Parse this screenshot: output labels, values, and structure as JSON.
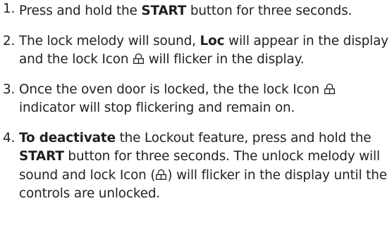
{
  "steps": [
    {
      "num": "1.",
      "t1": "Press and hold the ",
      "b1": "START",
      "t2": " button for three seconds."
    },
    {
      "num": "2.",
      "t1": "The lock melody will sound, ",
      "b1": "Loc",
      "t2": " will appear in the display and the lock Icon ",
      "t3": " will flicker in the display."
    },
    {
      "num": "3.",
      "t1": "Once the oven door is locked, the the lock Icon ",
      "t2": " indicator will stop flickering and remain on."
    },
    {
      "num": "4.",
      "b1": "To deactivate",
      "t1": " the Lockout feature, press and hold the ",
      "b2": "START",
      "t2": " button for three seconds. The unlock melody will sound and lock Icon (",
      "t3": ") will flicker in the display until the controls are unlocked."
    }
  ],
  "icon": "lock-icon"
}
